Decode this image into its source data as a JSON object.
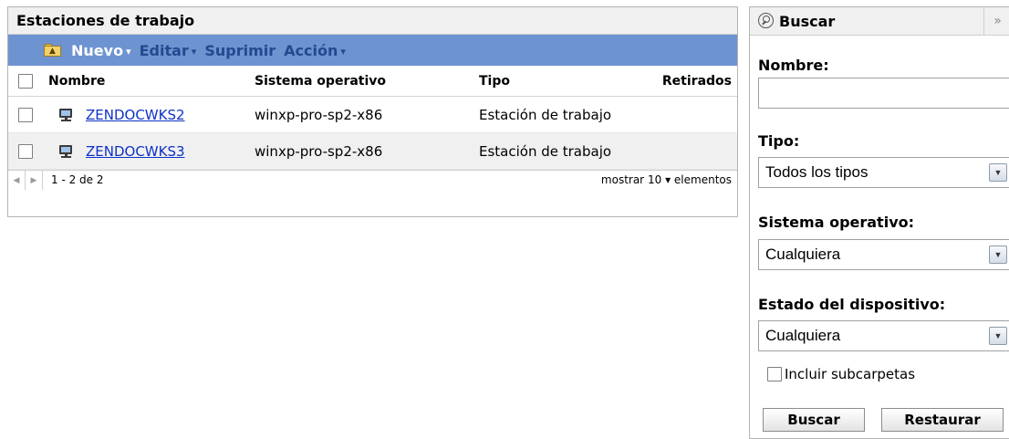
{
  "workstations_panel": {
    "title": "Estaciones de trabajo",
    "toolbar": {
      "new_label": "Nuevo",
      "edit_label": "Editar",
      "delete_label": "Suprimir",
      "action_label": "Acción",
      "caret": "▾"
    },
    "columns": {
      "name": "Nombre",
      "os": "Sistema operativo",
      "type": "Tipo",
      "retired": "Retirados"
    },
    "rows": [
      {
        "name": "ZENDOCWKS2",
        "os": "winxp-pro-sp2-x86",
        "type": "Estación de trabajo",
        "retired": ""
      },
      {
        "name": "ZENDOCWKS3",
        "os": "winxp-pro-sp2-x86",
        "type": "Estación de trabajo",
        "retired": ""
      }
    ],
    "pager": {
      "range": "1 - 2 de 2",
      "show_label": "mostrar",
      "page_size": "10",
      "items_label": "elementos"
    }
  },
  "search_panel": {
    "title": "Buscar",
    "collapse_glyph": "»",
    "name_label": "Nombre:",
    "name_value": "",
    "type_label": "Tipo:",
    "type_value": "Todos los tipos",
    "os_label": "Sistema operativo:",
    "os_value": "Cualquiera",
    "status_label": "Estado del dispositivo:",
    "status_value": "Cualquiera",
    "include_subfolders_label": "Incluir subcarpetas",
    "include_subfolders_checked": false,
    "search_button": "Buscar",
    "reset_button": "Restaurar"
  },
  "colors": {
    "toolbar_bg": "#6d94d1",
    "toolbar_active_text": "#ffffff",
    "toolbar_text": "#24498f",
    "link": "#0d32c7",
    "row_alt": "#f0f0f0"
  }
}
